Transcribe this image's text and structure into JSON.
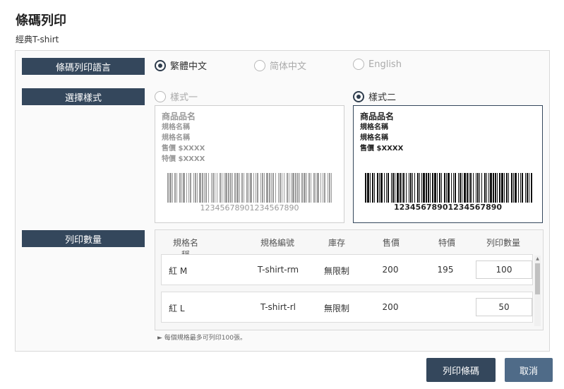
{
  "header": {
    "title": "條碼列印",
    "subtitle": "經典T-shirt"
  },
  "language": {
    "label": "條碼列印語言",
    "options": [
      {
        "label": "繁體中文",
        "selected": true
      },
      {
        "label": "简体中文",
        "selected": false
      },
      {
        "label": "English",
        "selected": false
      }
    ]
  },
  "style_select": {
    "label": "選擇樣式",
    "options": [
      {
        "label": "樣式一",
        "selected": false
      },
      {
        "label": "樣式二",
        "selected": true
      }
    ],
    "preview": {
      "product_name": "商品品名",
      "spec1": "規格名稱",
      "spec2": "規格名稱",
      "price": "售價 $XXXX",
      "special_price": "特價 $XXXX",
      "barcode_number": "12345678901234567890"
    }
  },
  "print_qty": {
    "label": "列印數量",
    "columns": [
      "規格名稱",
      "規格編號",
      "庫存",
      "售價",
      "特價",
      "列印數量"
    ],
    "rows": [
      {
        "spec": "紅 M",
        "code": "T-shirt-rm",
        "stock": "無限制",
        "price": "200",
        "special": "195",
        "qty": "100"
      },
      {
        "spec": "紅 L",
        "code": "T-shirt-rl",
        "stock": "無限制",
        "price": "200",
        "special": "",
        "qty": "50"
      }
    ],
    "note": "► 每個規格最多可列印100張。"
  },
  "actions": {
    "print_label": "列印條碼",
    "cancel_label": "取消"
  },
  "colors": {
    "primary": "#34475c",
    "cancel": "#4f6b88"
  }
}
